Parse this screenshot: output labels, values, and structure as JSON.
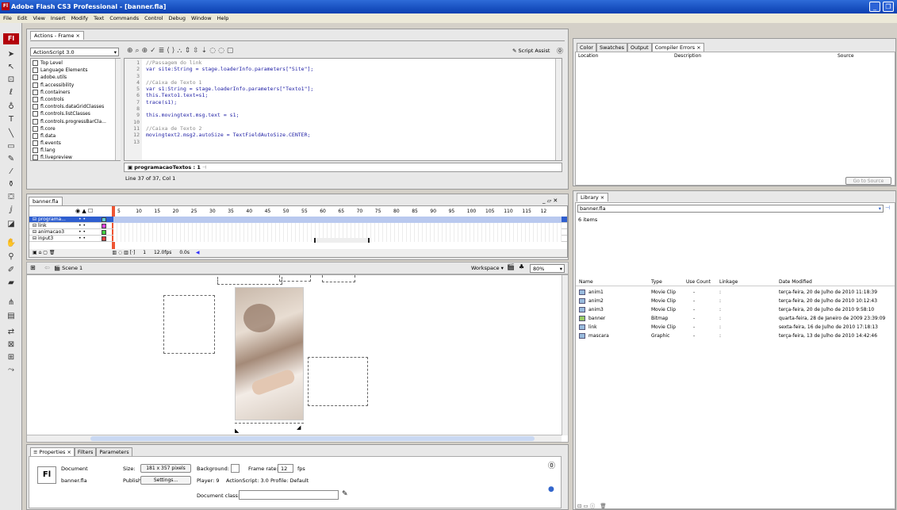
{
  "window": {
    "title": "Adobe Flash CS3 Professional - [banner.fla]",
    "app_icon": "Fl"
  },
  "menu": [
    "File",
    "Edit",
    "View",
    "Insert",
    "Modify",
    "Text",
    "Commands",
    "Control",
    "Debug",
    "Window",
    "Help"
  ],
  "toolbox": {
    "badge": "Fl"
  },
  "actions": {
    "tab": "Actions - Frame",
    "language": "ActionScript 3.0",
    "script_assist": "Script Assist",
    "tree": [
      "Top Level",
      "Language Elements",
      "adobe.utils",
      "fl.accessibility",
      "fl.containers",
      "fl.controls",
      "fl.controls.dataGridClasses",
      "fl.controls.listClasses",
      "fl.controls.progressBarCla...",
      "fl.core",
      "fl.data",
      "fl.events",
      "fl.lang",
      "fl.livepreview"
    ],
    "line_numbers": [
      "1",
      "2",
      "3",
      "4",
      "5",
      "6",
      "7",
      "8",
      "9",
      "10",
      "11",
      "12",
      "13"
    ],
    "code": [
      {
        "t": "//Passagem do link",
        "c": "cm"
      },
      {
        "t": "var site:String = stage.loaderInfo.parameters[\"Site\"];",
        "c": "kw"
      },
      {
        "t": "",
        "c": ""
      },
      {
        "t": "//Caixa de Texto 1",
        "c": "cm"
      },
      {
        "t": "var s1:String = stage.loaderInfo.parameters[\"Texto1\"];",
        "c": "kw"
      },
      {
        "t": "this.Texto1.text=s1;",
        "c": "kw"
      },
      {
        "t": "trace(s1);",
        "c": "kw"
      },
      {
        "t": "",
        "c": ""
      },
      {
        "t": "this.movingtext.msg.text = s1;",
        "c": "kw"
      },
      {
        "t": "",
        "c": ""
      },
      {
        "t": "//Caixa de Texto 2",
        "c": "cm"
      },
      {
        "t": "movingtext2.msg2.autoSize = TextFieldAutoSize.CENTER;",
        "c": "kw"
      },
      {
        "t": "",
        "c": ""
      }
    ],
    "frame_tab": "programacaoTextos : 1",
    "status": "Line 37 of 37, Col 1"
  },
  "errors": {
    "tabs": [
      "Color",
      "Swatches",
      "Output",
      "Compiler Errors"
    ],
    "columns": [
      "Location",
      "Description",
      "Source"
    ],
    "go_to_source": "Go to Source"
  },
  "timeline": {
    "doc_tab": "banner.fla",
    "frame_numbers": [
      "5",
      "10",
      "15",
      "20",
      "25",
      "30",
      "35",
      "40",
      "45",
      "50",
      "55",
      "60",
      "65",
      "70",
      "75",
      "80",
      "85",
      "90",
      "95",
      "100",
      "105",
      "110",
      "115",
      "12"
    ],
    "layers": [
      {
        "name": "programa...",
        "color": "#5ed0d8",
        "selected": true
      },
      {
        "name": "link",
        "color": "#e040e0",
        "selected": false
      },
      {
        "name": "animacao3",
        "color": "#40d040",
        "selected": false
      },
      {
        "name": "input3",
        "color": "#e04040",
        "selected": false
      }
    ],
    "current_frame": "1",
    "fps": "12.0fps",
    "time": "0.0s"
  },
  "stage": {
    "scene": "Scene 1",
    "workspace": "Workspace ▾",
    "zoom": "80%"
  },
  "properties": {
    "tabs": [
      "Properties",
      "Filters",
      "Parameters"
    ],
    "doc_label": "Document",
    "doc_name": "banner.fla",
    "size_label": "Size:",
    "size_value": "181 x 357 pixels",
    "background_label": "Background:",
    "frame_rate_label": "Frame rate:",
    "frame_rate": "12",
    "fps_unit": "fps",
    "publish_label": "Publish:",
    "settings_button": "Settings...",
    "player": "Player: 9",
    "actionscript": "ActionScript: 3.0",
    "profile": "Profile: Default",
    "doc_class_label": "Document class:"
  },
  "library": {
    "tab": "Library",
    "file": "banner.fla",
    "count": "6 items",
    "columns": [
      "Name",
      "Type",
      "Use Count",
      "Linkage",
      "Date Modified"
    ],
    "items": [
      {
        "name": "anim1",
        "type": "Movie Clip",
        "use": "-",
        "link": ":",
        "date": "terça-feira, 20 de Julho de 2010 11:18:39"
      },
      {
        "name": "anim2",
        "type": "Movie Clip",
        "use": "-",
        "link": ":",
        "date": "terça-feira, 20 de Julho de 2010 10:12:43"
      },
      {
        "name": "anim3",
        "type": "Movie Clip",
        "use": "-",
        "link": ":",
        "date": "terça-feira, 20 de Julho de 2010 9:58:10"
      },
      {
        "name": "banner",
        "type": "Bitmap",
        "use": "-",
        "link": ":",
        "date": "quarta-feira, 28 de Janeiro de 2009 23:39:09"
      },
      {
        "name": "link",
        "type": "Movie Clip",
        "use": "-",
        "link": ":",
        "date": "sexta-feira, 16 de Julho de 2010 17:18:13"
      },
      {
        "name": "mascara",
        "type": "Graphic",
        "use": "-",
        "link": ":",
        "date": "terça-feira, 13 de Julho de 2010 14:42:46"
      }
    ]
  }
}
